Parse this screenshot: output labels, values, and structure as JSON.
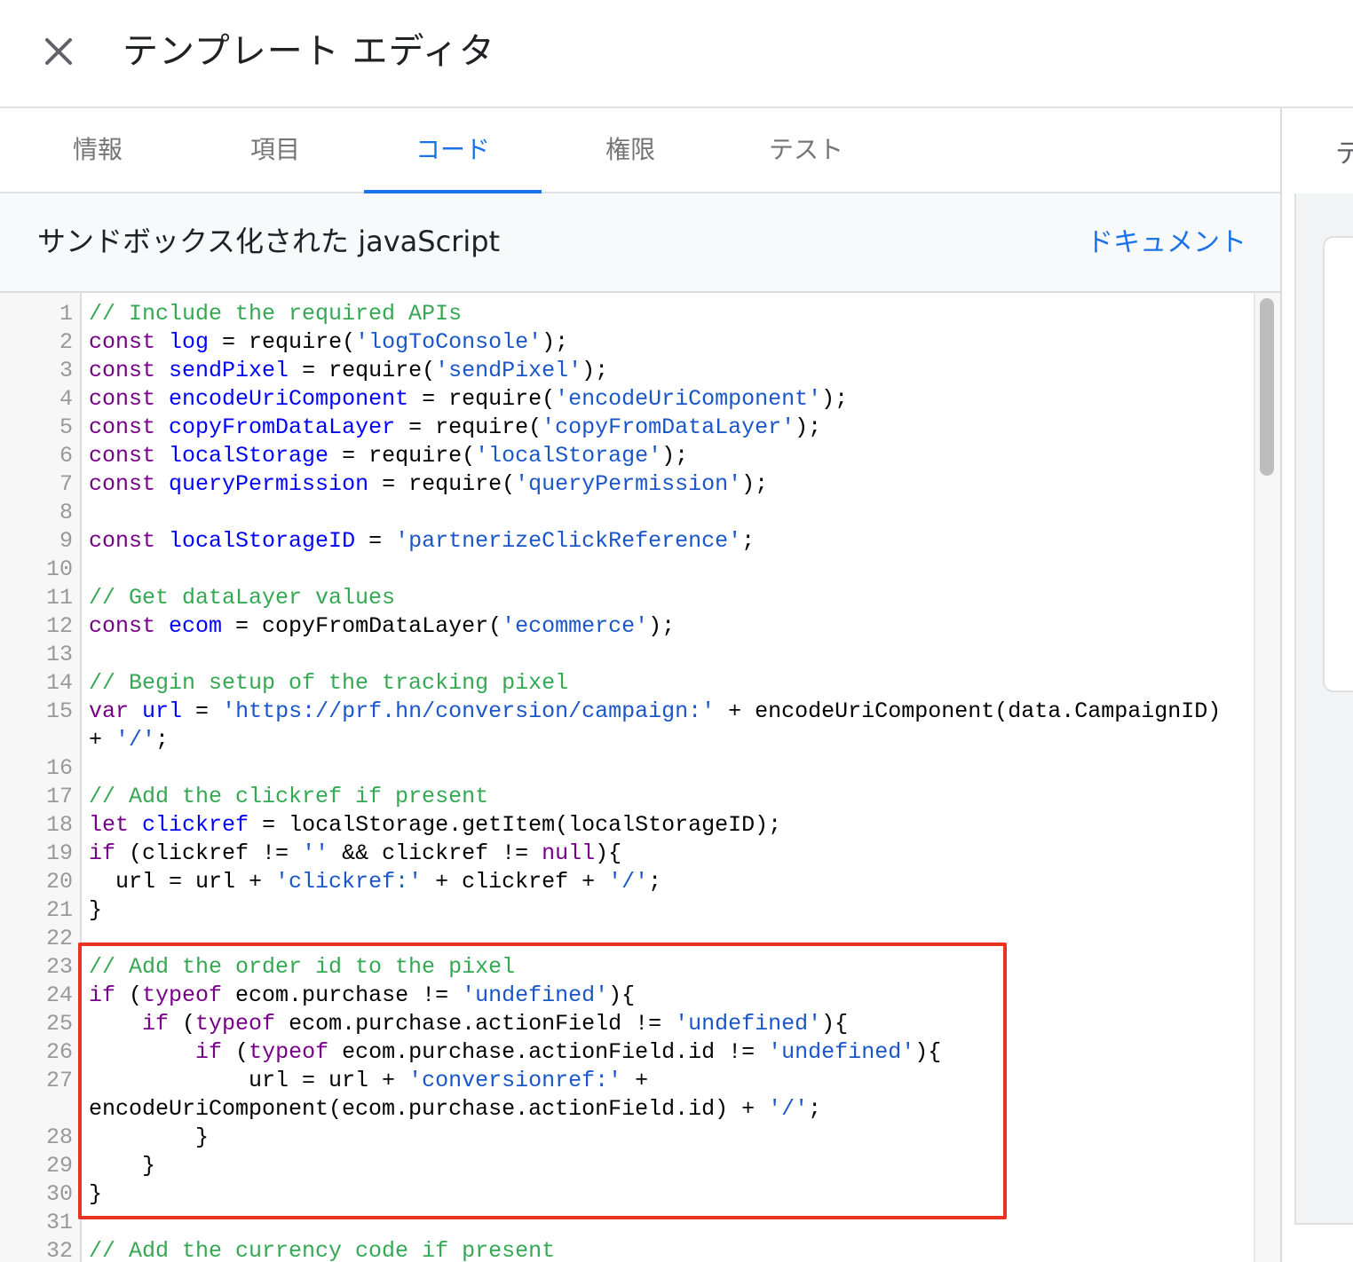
{
  "header": {
    "title": "テンプレート エディタ",
    "close_icon": "close-icon"
  },
  "tabs": [
    {
      "label": "情報",
      "active": false
    },
    {
      "label": "項目",
      "active": false
    },
    {
      "label": "コード",
      "active": true
    },
    {
      "label": "権限",
      "active": false
    },
    {
      "label": "テスト",
      "active": false
    }
  ],
  "right_panel": {
    "tab_label": "テ"
  },
  "section": {
    "title": "サンドボックス化された javaScript",
    "doc_link": "ドキュメント"
  },
  "editor": {
    "highlighted_lines": [
      23,
      30
    ],
    "lines": [
      {
        "n": "1",
        "tokens": [
          [
            "cm",
            "// Include the required APIs"
          ]
        ]
      },
      {
        "n": "2",
        "tokens": [
          [
            "kw",
            "const"
          ],
          [
            "op",
            " "
          ],
          [
            "def",
            "log"
          ],
          [
            "op",
            " = require("
          ],
          [
            "str",
            "'logToConsole'"
          ],
          [
            "op",
            ");"
          ]
        ]
      },
      {
        "n": "3",
        "tokens": [
          [
            "kw",
            "const"
          ],
          [
            "op",
            " "
          ],
          [
            "def",
            "sendPixel"
          ],
          [
            "op",
            " = require("
          ],
          [
            "str",
            "'sendPixel'"
          ],
          [
            "op",
            ");"
          ]
        ]
      },
      {
        "n": "4",
        "tokens": [
          [
            "kw",
            "const"
          ],
          [
            "op",
            " "
          ],
          [
            "def",
            "encodeUriComponent"
          ],
          [
            "op",
            " = require("
          ],
          [
            "str",
            "'encodeUriComponent'"
          ],
          [
            "op",
            ");"
          ]
        ]
      },
      {
        "n": "5",
        "tokens": [
          [
            "kw",
            "const"
          ],
          [
            "op",
            " "
          ],
          [
            "def",
            "copyFromDataLayer"
          ],
          [
            "op",
            " = require("
          ],
          [
            "str",
            "'copyFromDataLayer'"
          ],
          [
            "op",
            ");"
          ]
        ]
      },
      {
        "n": "6",
        "tokens": [
          [
            "kw",
            "const"
          ],
          [
            "op",
            " "
          ],
          [
            "def",
            "localStorage"
          ],
          [
            "op",
            " = require("
          ],
          [
            "str",
            "'localStorage'"
          ],
          [
            "op",
            ");"
          ]
        ]
      },
      {
        "n": "7",
        "tokens": [
          [
            "kw",
            "const"
          ],
          [
            "op",
            " "
          ],
          [
            "def",
            "queryPermission"
          ],
          [
            "op",
            " = require("
          ],
          [
            "str",
            "'queryPermission'"
          ],
          [
            "op",
            ");"
          ]
        ]
      },
      {
        "n": "8",
        "tokens": []
      },
      {
        "n": "9",
        "tokens": [
          [
            "kw",
            "const"
          ],
          [
            "op",
            " "
          ],
          [
            "def",
            "localStorageID"
          ],
          [
            "op",
            " = "
          ],
          [
            "str",
            "'partnerizeClickReference'"
          ],
          [
            "op",
            ";"
          ]
        ]
      },
      {
        "n": "10",
        "tokens": []
      },
      {
        "n": "11",
        "tokens": [
          [
            "cm",
            "// Get dataLayer values"
          ]
        ]
      },
      {
        "n": "12",
        "tokens": [
          [
            "kw",
            "const"
          ],
          [
            "op",
            " "
          ],
          [
            "def",
            "ecom"
          ],
          [
            "op",
            " = copyFromDataLayer("
          ],
          [
            "str",
            "'ecommerce'"
          ],
          [
            "op",
            ");"
          ]
        ]
      },
      {
        "n": "13",
        "tokens": []
      },
      {
        "n": "14",
        "tokens": [
          [
            "cm",
            "// Begin setup of the tracking pixel"
          ]
        ]
      },
      {
        "n": "15",
        "tokens": [
          [
            "kw",
            "var"
          ],
          [
            "op",
            " "
          ],
          [
            "def",
            "url"
          ],
          [
            "op",
            " = "
          ],
          [
            "str",
            "'https://prf.hn/conversion/campaign:'"
          ],
          [
            "op",
            " + encodeUriComponent(data.CampaignID)"
          ]
        ]
      },
      {
        "n": "",
        "tokens": [
          [
            "op",
            "+ "
          ],
          [
            "str",
            "'/'"
          ],
          [
            "op",
            ";"
          ]
        ]
      },
      {
        "n": "16",
        "tokens": []
      },
      {
        "n": "17",
        "tokens": [
          [
            "cm",
            "// Add the clickref if present"
          ]
        ]
      },
      {
        "n": "18",
        "tokens": [
          [
            "kw",
            "let"
          ],
          [
            "op",
            " "
          ],
          [
            "def",
            "clickref"
          ],
          [
            "op",
            " = localStorage.getItem(localStorageID);"
          ]
        ]
      },
      {
        "n": "19",
        "tokens": [
          [
            "kw",
            "if"
          ],
          [
            "op",
            " (clickref != "
          ],
          [
            "str",
            "''"
          ],
          [
            "op",
            " && clickref != "
          ],
          [
            "kw",
            "null"
          ],
          [
            "op",
            "){"
          ]
        ]
      },
      {
        "n": "20",
        "tokens": [
          [
            "op",
            "  url = url + "
          ],
          [
            "str",
            "'clickref:'"
          ],
          [
            "op",
            " + clickref + "
          ],
          [
            "str",
            "'/'"
          ],
          [
            "op",
            ";"
          ]
        ]
      },
      {
        "n": "21",
        "tokens": [
          [
            "op",
            "}"
          ]
        ]
      },
      {
        "n": "22",
        "tokens": []
      },
      {
        "n": "23",
        "tokens": [
          [
            "cm",
            "// Add the order id to the pixel"
          ]
        ]
      },
      {
        "n": "24",
        "tokens": [
          [
            "kw",
            "if"
          ],
          [
            "op",
            " ("
          ],
          [
            "kw",
            "typeof"
          ],
          [
            "op",
            " ecom.purchase != "
          ],
          [
            "str",
            "'undefined'"
          ],
          [
            "op",
            "){"
          ]
        ]
      },
      {
        "n": "25",
        "tokens": [
          [
            "op",
            "    "
          ],
          [
            "kw",
            "if"
          ],
          [
            "op",
            " ("
          ],
          [
            "kw",
            "typeof"
          ],
          [
            "op",
            " ecom.purchase.actionField != "
          ],
          [
            "str",
            "'undefined'"
          ],
          [
            "op",
            "){"
          ]
        ]
      },
      {
        "n": "26",
        "tokens": [
          [
            "op",
            "        "
          ],
          [
            "kw",
            "if"
          ],
          [
            "op",
            " ("
          ],
          [
            "kw",
            "typeof"
          ],
          [
            "op",
            " ecom.purchase.actionField.id != "
          ],
          [
            "str",
            "'undefined'"
          ],
          [
            "op",
            "){"
          ]
        ]
      },
      {
        "n": "27",
        "tokens": [
          [
            "op",
            "            url = url + "
          ],
          [
            "str",
            "'conversionref:'"
          ],
          [
            "op",
            " +"
          ]
        ]
      },
      {
        "n": "",
        "tokens": [
          [
            "op",
            "encodeUriComponent(ecom.purchase.actionField.id) + "
          ],
          [
            "str",
            "'/'"
          ],
          [
            "op",
            ";"
          ]
        ]
      },
      {
        "n": "28",
        "tokens": [
          [
            "op",
            "        }"
          ]
        ]
      },
      {
        "n": "29",
        "tokens": [
          [
            "op",
            "    }"
          ]
        ]
      },
      {
        "n": "30",
        "tokens": [
          [
            "op",
            "}"
          ]
        ]
      },
      {
        "n": "31",
        "tokens": []
      },
      {
        "n": "32",
        "tokens": [
          [
            "cm",
            "// Add the currency code if present"
          ]
        ]
      }
    ]
  },
  "colors": {
    "accent": "#1a73e8",
    "highlight_border": "#ea3323",
    "comment": "#34a853",
    "keyword": "#770088",
    "definition": "#0000ff",
    "string": "#1a56c8"
  }
}
